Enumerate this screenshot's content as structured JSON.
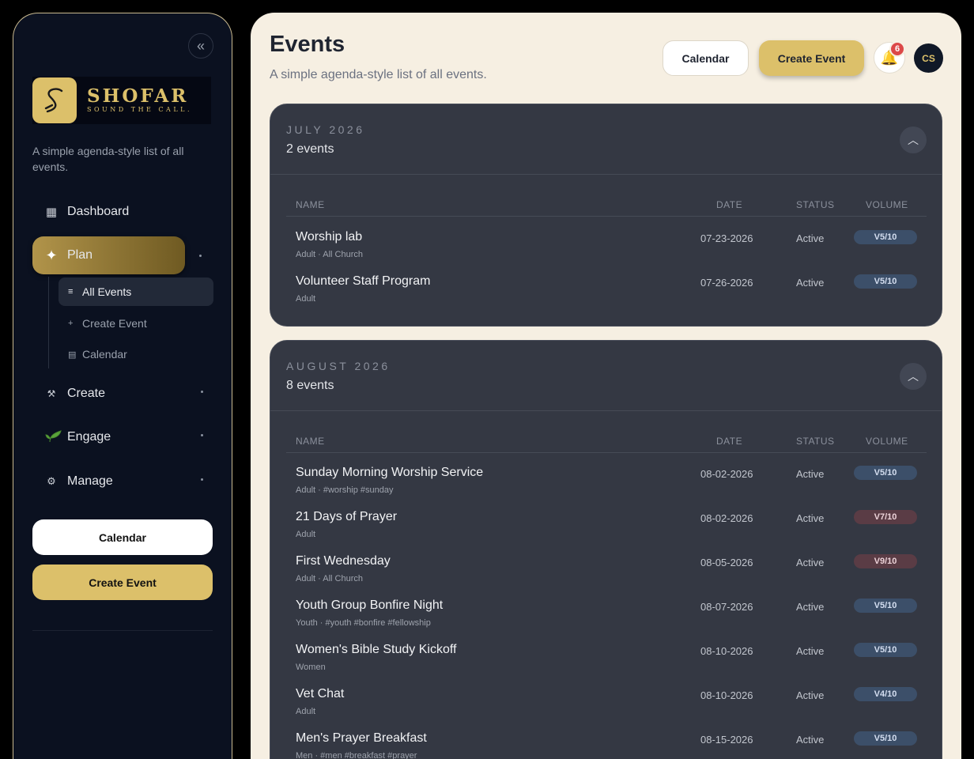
{
  "sidebar": {
    "collapse_icon": "double-chevron-left-icon",
    "brand": {
      "name": "SHOFAR",
      "tagline": "SOUND THE CALL.",
      "mark": "S"
    },
    "subtitle": "A simple agenda-style list of all events.",
    "nav": [
      {
        "label": "Dashboard",
        "icon": "grid-icon"
      },
      {
        "label": "Plan",
        "icon": "sparkle-icon",
        "active": true
      },
      {
        "label": "Create",
        "icon": "hammer-icon"
      },
      {
        "label": "Engage",
        "icon": "sprout-icon"
      },
      {
        "label": "Manage",
        "icon": "gear-icon"
      }
    ],
    "plan_sub": [
      {
        "label": "All Events",
        "icon": "list-icon",
        "active": true
      },
      {
        "label": "Create Event",
        "icon": "plus-icon"
      },
      {
        "label": "Calendar",
        "icon": "calendar-icon"
      }
    ],
    "calendar_button": "Calendar",
    "create_button": "Create Event"
  },
  "header": {
    "title": "Events",
    "subtitle": "A simple agenda-style list of all events.",
    "calendar_button": "Calendar",
    "create_button": "Create Event",
    "notification_count": "6",
    "avatar_initials": "CS"
  },
  "columns": {
    "name": "NAME",
    "date": "DATE",
    "status": "STATUS",
    "volume": "VOLUME"
  },
  "groups": [
    {
      "month": "JULY 2026",
      "count": "2 events",
      "events": [
        {
          "name": "Worship lab",
          "meta": "Adult · All Church",
          "date": "07-23-2026",
          "status": "Active",
          "volume": "V5/10",
          "vol_color": "blue"
        },
        {
          "name": "Volunteer Staff Program",
          "meta": "Adult",
          "date": "07-26-2026",
          "status": "Active",
          "volume": "V5/10",
          "vol_color": "blue"
        }
      ]
    },
    {
      "month": "AUGUST 2026",
      "count": "8 events",
      "events": [
        {
          "name": "Sunday Morning Worship Service",
          "meta": "Adult · #worship #sunday",
          "date": "08-02-2026",
          "status": "Active",
          "volume": "V5/10",
          "vol_color": "blue"
        },
        {
          "name": "21 Days of Prayer",
          "meta": "Adult",
          "date": "08-02-2026",
          "status": "Active",
          "volume": "V7/10",
          "vol_color": "red"
        },
        {
          "name": "First Wednesday",
          "meta": "Adult · All Church",
          "date": "08-05-2026",
          "status": "Active",
          "volume": "V9/10",
          "vol_color": "red"
        },
        {
          "name": "Youth Group Bonfire Night",
          "meta": "Youth · #youth #bonfire #fellowship",
          "date": "08-07-2026",
          "status": "Active",
          "volume": "V5/10",
          "vol_color": "blue"
        },
        {
          "name": "Women's Bible Study Kickoff",
          "meta": "Women",
          "date": "08-10-2026",
          "status": "Active",
          "volume": "V5/10",
          "vol_color": "blue"
        },
        {
          "name": "Vet Chat",
          "meta": "Adult",
          "date": "08-10-2026",
          "status": "Active",
          "volume": "V4/10",
          "vol_color": "blue"
        },
        {
          "name": "Men's Prayer Breakfast",
          "meta": "Men · #men #breakfast #prayer",
          "date": "08-15-2026",
          "status": "Active",
          "volume": "V5/10",
          "vol_color": "blue"
        }
      ]
    }
  ]
}
